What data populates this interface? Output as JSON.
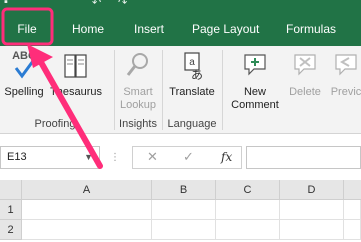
{
  "ribbon_tabs": [
    {
      "label": "File"
    },
    {
      "label": "Home"
    },
    {
      "label": "Insert"
    },
    {
      "label": "Page Layout"
    },
    {
      "label": "Formulas"
    }
  ],
  "groups": {
    "proofing": {
      "label": "Proofing",
      "spelling": {
        "icon_text": "ABC",
        "label": "Spelling"
      },
      "thesaurus": {
        "label": "Thesaurus"
      }
    },
    "insights": {
      "label": "Insights",
      "smart_lookup": {
        "label_line1": "Smart",
        "label_line2": "Lookup"
      }
    },
    "language": {
      "label": "Language",
      "translate": {
        "label": "Translate",
        "icon_glyph": "あ"
      }
    },
    "comments": {
      "new_comment": {
        "label_line1": "New",
        "label_line2": "Comment"
      },
      "delete": {
        "label": "Delete"
      },
      "previous": {
        "label": "Previc"
      }
    }
  },
  "formula_bar": {
    "name_box": "E13",
    "cancel_glyph": "✕",
    "enter_glyph": "✓",
    "fx_label": "fx"
  },
  "grid": {
    "columns": [
      "A",
      "B",
      "C",
      "D"
    ],
    "rows": [
      "1",
      "2"
    ]
  },
  "colors": {
    "excel_green": "#217346",
    "annotation_pink": "#ff2d7a"
  }
}
